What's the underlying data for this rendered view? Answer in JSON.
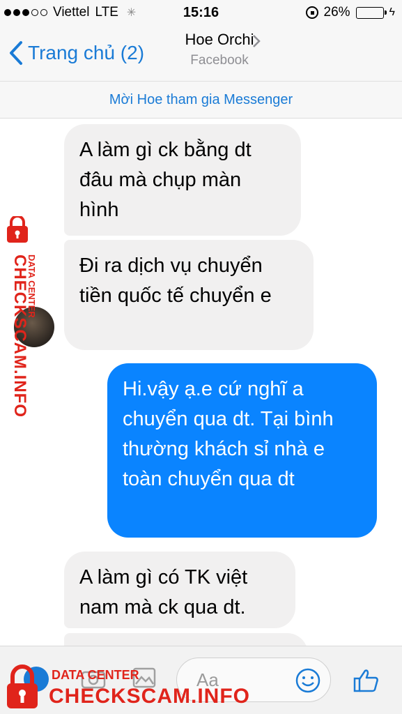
{
  "status": {
    "carrier": "Viettel",
    "network": "LTE",
    "time": "15:16",
    "battery": "26%",
    "battery_level": 0.26
  },
  "header": {
    "back_label": "Trang chủ (2)",
    "title": "Hoe Orchi",
    "subtitle": "Facebook"
  },
  "banner": {
    "text": "Mời Hoe tham gia Messenger"
  },
  "messages": [
    {
      "dir": "in",
      "text": "A làm gì ck bằng dt đâu mà chụp màn hình"
    },
    {
      "dir": "in",
      "text": "Đi ra dịch vụ chuyển tiền quốc tế chuyển e"
    },
    {
      "dir": "out",
      "text": "Hi.vậy ạ.e cứ nghĩ a chuyển qua dt. Tại bình thường khách sỉ nhà e toàn chuyển qua dt"
    },
    {
      "dir": "in",
      "text": "A làm gì có TK việt nam mà ck qua dt."
    },
    {
      "dir": "in",
      "text": ""
    }
  ],
  "composer": {
    "placeholder": "Aa"
  },
  "watermark": {
    "small": "DATA CENTER",
    "big": "CHECKSCAM.INFO",
    "color": "#e0241b"
  },
  "colors": {
    "accent": "#1a7bd6",
    "outgoing": "#0a84ff",
    "incoming": "#f1f0f0"
  }
}
